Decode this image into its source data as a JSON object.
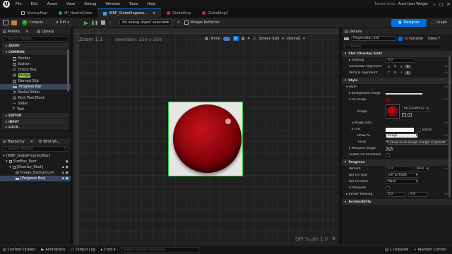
{
  "menu": {
    "items": [
      "File",
      "Edit",
      "Asset",
      "View",
      "Debug",
      "Window",
      "Tools",
      "Help"
    ],
    "parent_class_label": "Parent class:",
    "parent_class_value": "Aura User Widget"
  },
  "tabs": [
    {
      "label": "StartupMap",
      "active": false
    },
    {
      "label": "MI_HealthGlobe",
      "active": false
    },
    {
      "label": "WBP_GlobeProgress...",
      "active": true
    },
    {
      "label": "GlobeRing",
      "active": false
    },
    {
      "label": "GlobeRing2",
      "active": false
    }
  ],
  "toolbar": {
    "compile": "Compile",
    "diff": "Diff",
    "debug_filter": "No debug object selected",
    "widget_reflector": "Widget Reflector",
    "designer": "Designer",
    "graph": "Graph"
  },
  "palette": {
    "title": "Palette",
    "library_tab": "Library",
    "search_placeholder": "Search Palette",
    "categories_top": [
      "AUDIO",
      "COMMON"
    ],
    "items": [
      "Border",
      "Button",
      "Check Box",
      "Image",
      "Named Slot",
      "Progress Bar",
      "Radial Slider",
      "Rich Text Block",
      "Slider",
      "Text"
    ],
    "selected": "Progress Bar",
    "categories_bottom": [
      "EDITOR",
      "INPUT",
      "LISTS"
    ]
  },
  "hierarchy": {
    "title": "Hierarchy",
    "bind_tab": "Bind Wi...",
    "search_placeholder": "Search Widgets",
    "nodes": [
      "[WBP_GlobeProgressBar]",
      "SizeBox_Root",
      "[Overlay_Root]",
      "Image_Background",
      "[Progress Bar]"
    ]
  },
  "viewport": {
    "zoom": "Zoom 1:1",
    "selection": "Selection: 250 x 250",
    "dpi": "DPI Scale 1.0",
    "none_label": "None",
    "counter": "4",
    "screen_size": "Screen Size",
    "desired": "Desired"
  },
  "details": {
    "title": "Details",
    "widget_name": "ProgressBar_416",
    "is_variable": "Is Variable",
    "open_label": "Open F",
    "search_placeholder": "Search",
    "slot_section": "Slot (Overlay Slot)",
    "padding_label": "Padding",
    "padding_value": "0.0",
    "halign_label": "Horizontal Alignment",
    "valign_label": "Vertical Alignment",
    "style_section": "Style",
    "style_sub": "Style",
    "bg_image": "Background Image",
    "fill_image": "Fill Image",
    "image_label": "Image",
    "image_asset": "MI_HealthGlo",
    "image_size": "Image Size",
    "tint": "Tint",
    "inherit": "Inherit",
    "draw_as": "Draw As",
    "draw_as_value": "Image",
    "tiling": "Tiling",
    "tooltip": "Draw as an image, margin is ignored",
    "marquee_image": "Marquee Image",
    "enable_fill": "Enable Fill Animation",
    "progress_section": "Progress",
    "percent_label": "Percent",
    "percent_value": "1.0",
    "bind_label": "Bind",
    "bar_fill_type_label": "Bar Fill Type",
    "bar_fill_type_value": "Left to Right",
    "bar_fill_style_label": "Bar Fill Style",
    "bar_fill_style_value": "Mask",
    "is_marquee": "Is Marquee",
    "border_padding": "Border Padding",
    "bp_x": "0.0",
    "bp_y": "0.0",
    "accessibility": "Accessibility"
  },
  "status": {
    "content_drawer": "Content Drawer",
    "animations": "Animations",
    "output_log": "Output Log",
    "cmd": "Cmd",
    "console_placeholder": "Enter Console Command",
    "unsaved": "1 Unsaved",
    "revision": "Revision Control"
  },
  "colors": {
    "accent": "#0070e0",
    "selection_outline": "#2ecc40",
    "globe_red": "#8b0000"
  }
}
